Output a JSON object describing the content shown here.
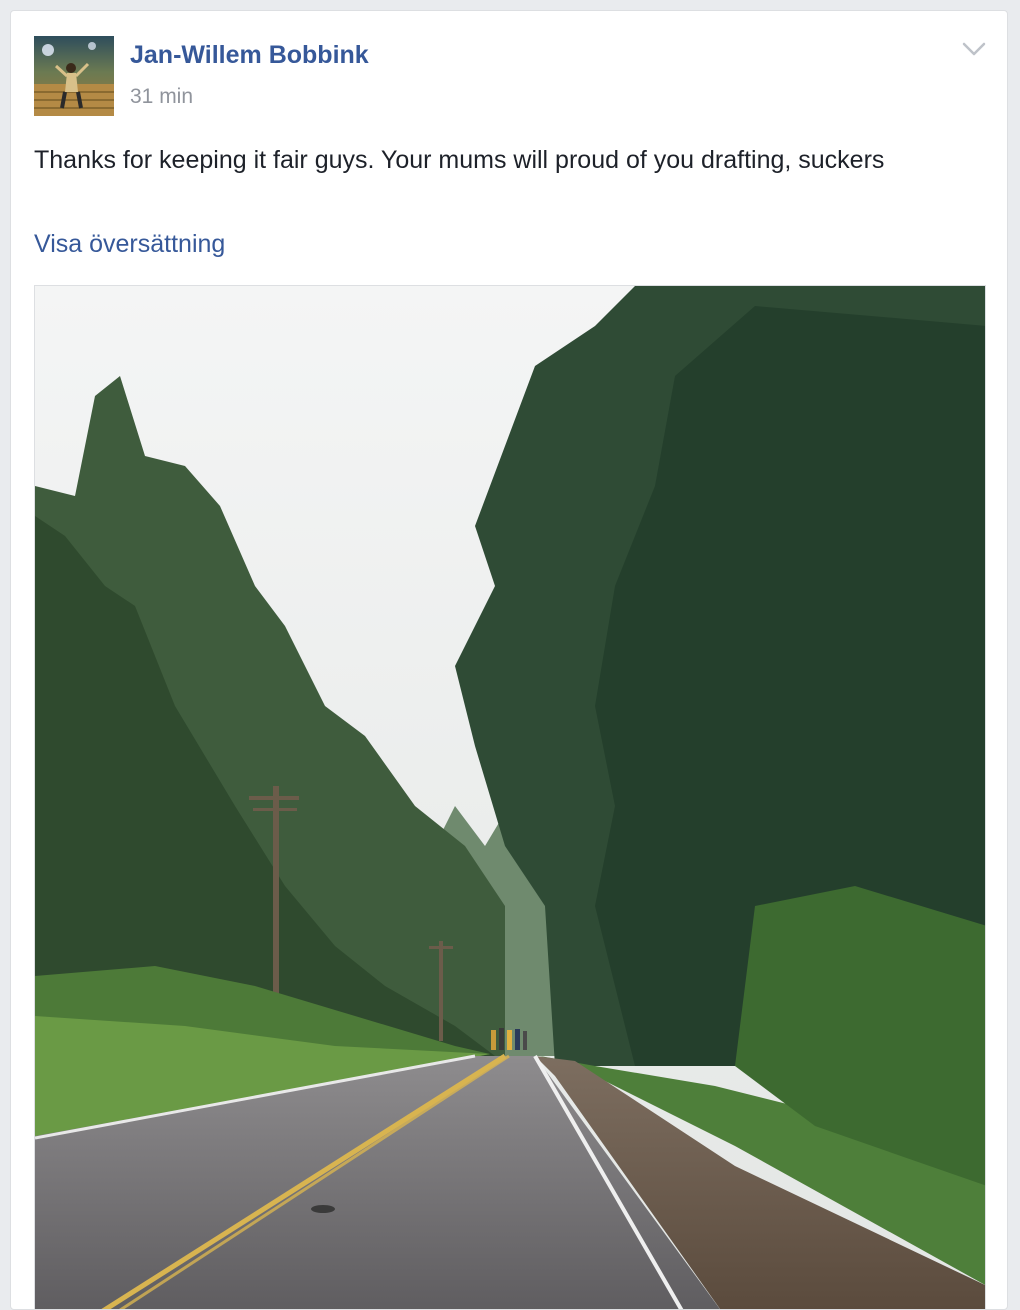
{
  "post": {
    "author": "Jan-Willem Bobbink",
    "timestamp": "31 min",
    "text": "Thanks for keeping it fair guys. Your mums will proud of you drafting, suckers",
    "translate_label": "Visa översättning",
    "icons": {
      "avatar": "profile-photo",
      "menu": "chevron-down-icon"
    },
    "photo_subject": "forest-road-with-runners"
  },
  "colors": {
    "link": "#365899",
    "meta": "#90949c",
    "text": "#1d2129",
    "background": "#e9ebee"
  }
}
